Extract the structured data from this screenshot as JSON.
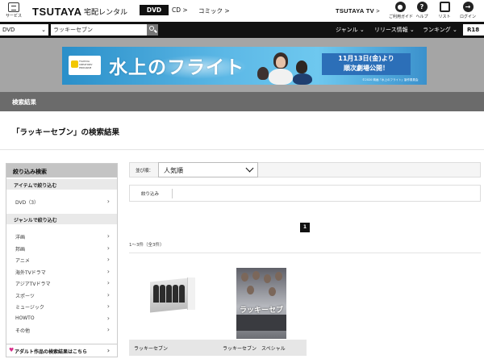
{
  "header": {
    "service_label": "サービス",
    "logo": "TSUTAYA",
    "logo_sub": "宅配レンタル",
    "nav": [
      {
        "label": "DVD",
        "active": true
      },
      {
        "label": "CD",
        "active": false
      },
      {
        "label": "コミック",
        "active": false
      }
    ],
    "tv_logo": "TSUTAYA TV",
    "icons": [
      {
        "icon": "guide-icon",
        "label": "ご利用ガイド"
      },
      {
        "icon": "help-icon",
        "label": "ヘルプ"
      },
      {
        "icon": "list-icon",
        "label": "リスト"
      },
      {
        "icon": "login-icon",
        "label": "ログイン"
      }
    ]
  },
  "searchbar": {
    "category": "DVD",
    "query": "ラッキーセブン",
    "menu": [
      "ジャンル",
      "リリース情報",
      "ランキング"
    ],
    "r18": "R18"
  },
  "banner": {
    "title": "水上のフライト",
    "badge": "TSUTAYA CREATORS' PROGRAM",
    "date_line1": "11月13日(金)より",
    "date_line2": "順次劇場公開！",
    "copyright": "©2020 映画「水上のフライト」製作委員会"
  },
  "results": {
    "bar_label": "検索結果",
    "title": "「ラッキーセブン」の検索結果",
    "count": "1～3件（全3件）",
    "page": "1"
  },
  "filters": {
    "head": "絞り込み検索",
    "item_section": "アイテムで絞り込む",
    "item_rows": [
      "DVD（3）"
    ],
    "genre_section": "ジャンルで絞り込む",
    "genre_rows": [
      "洋画",
      "邦画",
      "アニメ",
      "海外TVドラマ",
      "アジアTVドラマ",
      "スポーツ",
      "ミュージック",
      "HOWTO",
      "その他"
    ],
    "adult_link": "アダルト作品の検索結果はこちら"
  },
  "sort": {
    "label": "並び順：",
    "value": "人気順"
  },
  "refine": {
    "label": "絞り込み"
  },
  "products": [
    {
      "title": "ラッキーセブン"
    },
    {
      "title": "ラッキーセブン　スペシャル"
    }
  ],
  "poster_text": "ラッキーセブン",
  "colors": {
    "header_black": "#111111",
    "result_bar": "#6b6b6b",
    "banner_bg": "#a5a5a5",
    "adult_heart": "#d8308b"
  }
}
